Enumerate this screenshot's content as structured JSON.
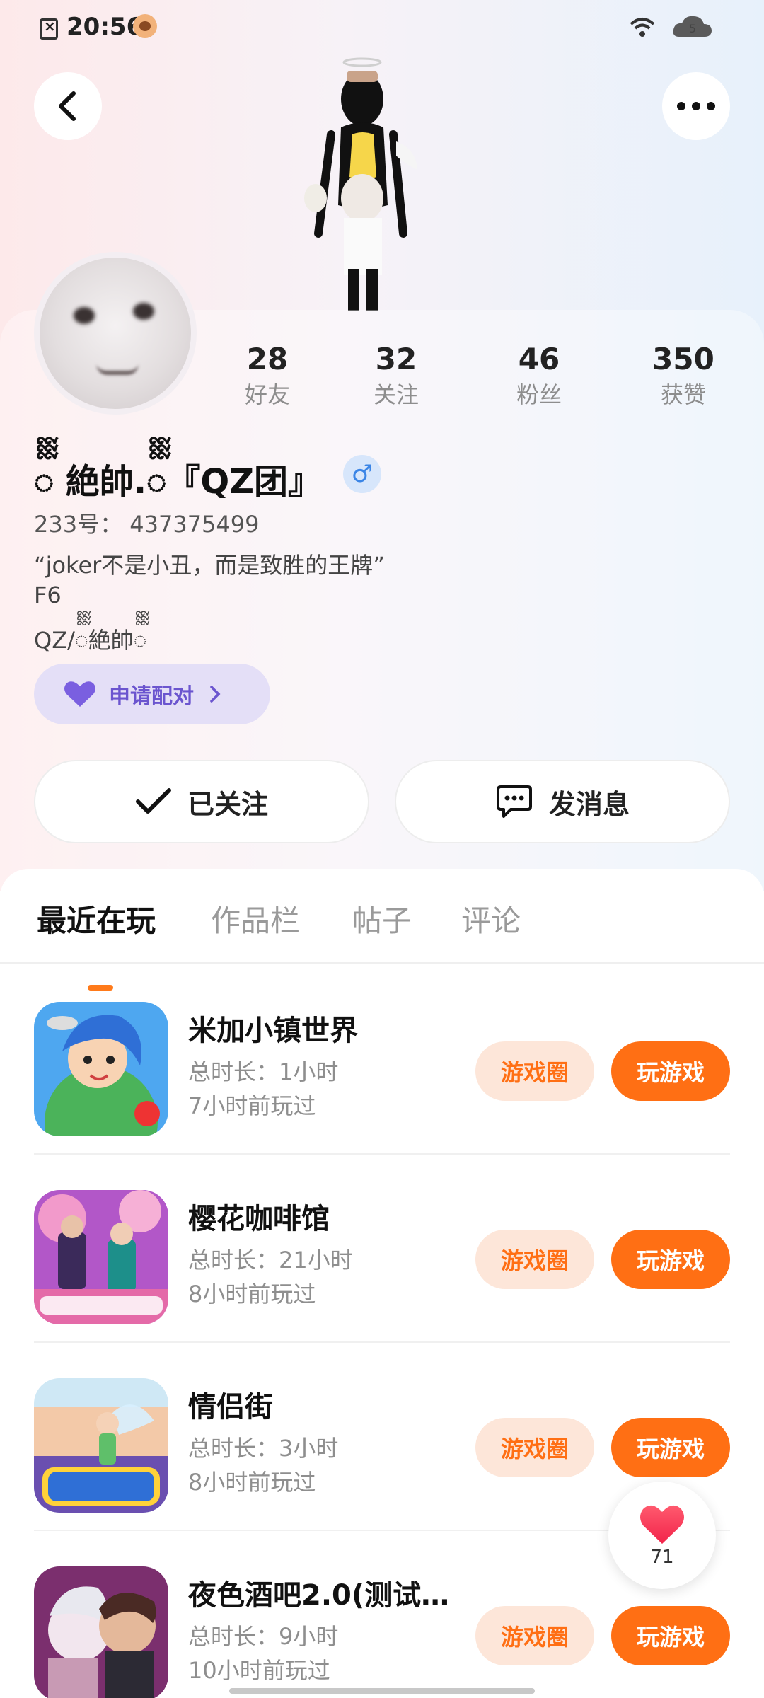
{
  "status_bar": {
    "time": "20:56",
    "battery_level": "5"
  },
  "profile": {
    "stats": [
      {
        "value": "28",
        "label": "好友"
      },
      {
        "value": "32",
        "label": "关注"
      },
      {
        "value": "46",
        "label": "粉丝"
      },
      {
        "value": "350",
        "label": "获赞"
      }
    ],
    "name": "ᢆ 絶帥.ᢆ『QZ团』",
    "gender_symbol": "♂",
    "id_line": "233号： 437375499",
    "bio": [
      "“joker不是小丑，而是致胜的王牌”",
      "F6",
      "QZ/ᢆ絶帥ᢆ"
    ],
    "pair_button": "申请配对",
    "follow_button": "已关注",
    "message_button": "发消息"
  },
  "tabs": [
    "最近在玩",
    "作品栏",
    "帖子",
    "评论"
  ],
  "games": [
    {
      "title": "米加小镇世界",
      "duration": "总时长：1小时",
      "last_played": "7小时前玩过",
      "circle_label": "游戏圈",
      "play_label": "玩游戏"
    },
    {
      "title": "樱花咖啡馆",
      "duration": "总时长：21小时",
      "last_played": "8小时前玩过",
      "circle_label": "游戏圈",
      "play_label": "玩游戏"
    },
    {
      "title": "情侣街",
      "duration": "总时长：3小时",
      "last_played": "8小时前玩过",
      "circle_label": "游戏圈",
      "play_label": "玩游戏"
    },
    {
      "title": "夜色酒吧2.0(测试…",
      "duration": "总时长：9小时",
      "last_played": "10小时前玩过",
      "circle_label": "游戏圈",
      "play_label": "玩游戏"
    }
  ],
  "like_fab": {
    "count": "71"
  },
  "colors": {
    "accent": "#ff6f14",
    "pair_purple": "#6b55cf",
    "gender_blue": "#3b85e6"
  }
}
